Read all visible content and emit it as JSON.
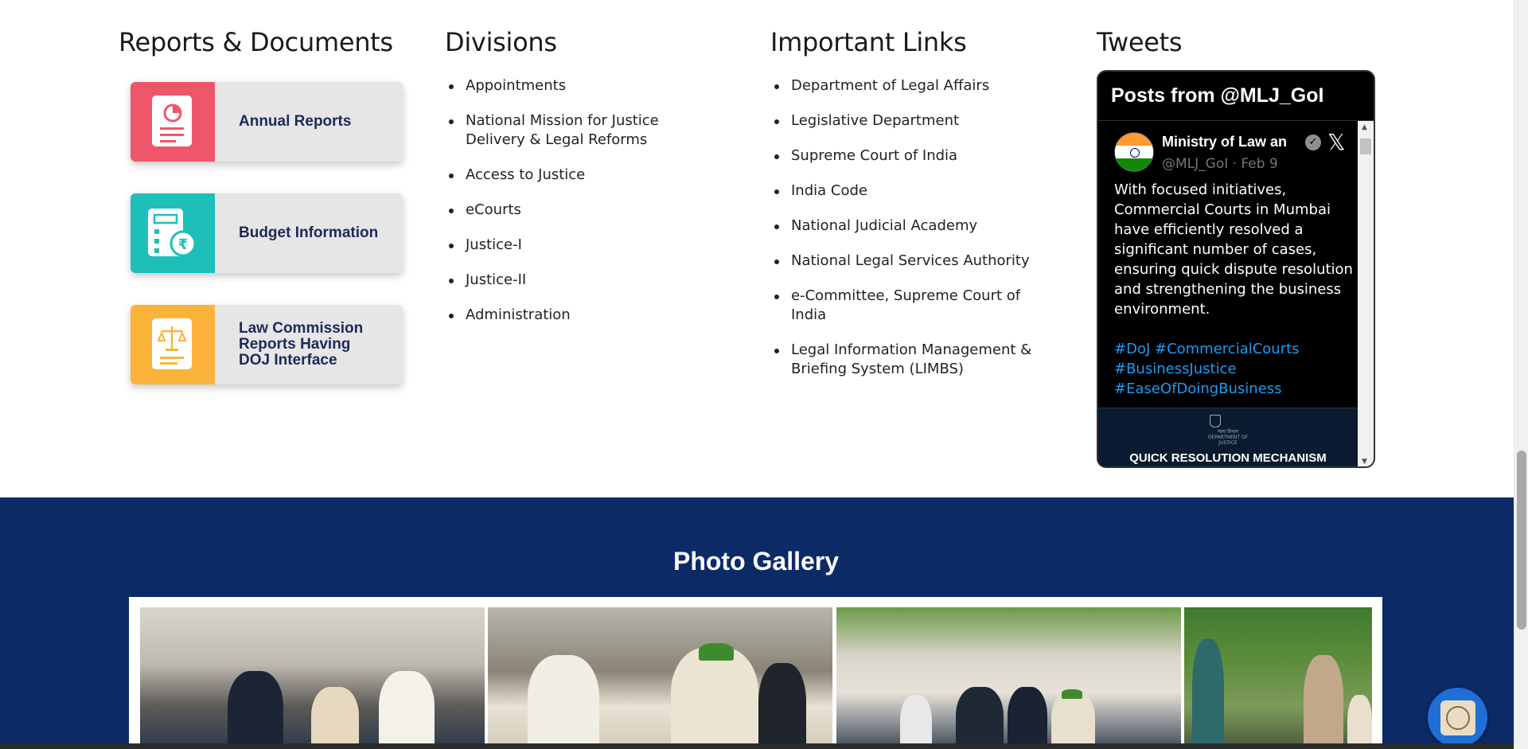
{
  "reports": {
    "heading": "Reports & Documents",
    "cards": [
      {
        "label": "Annual Reports",
        "color": "#f0566a"
      },
      {
        "label": "Budget Information",
        "color": "#1dbfb8"
      },
      {
        "label": "Law Commission Reports Having DOJ Interface",
        "color": "#fbb33a"
      }
    ]
  },
  "divisions": {
    "heading": "Divisions",
    "items": [
      "Appointments",
      "National Mission for Justice Delivery & Legal Reforms",
      "Access to Justice",
      "eCourts",
      "Justice-I",
      "Justice-II",
      "Administration"
    ]
  },
  "important_links": {
    "heading": "Important Links",
    "items": [
      "Department of Legal Affairs",
      "Legislative Department",
      "Supreme Court of India",
      "India Code",
      "National Judicial Academy",
      "National Legal Services Authority",
      "e-Committee, Supreme Court of India",
      "Legal Information Management & Briefing System (LIMBS)"
    ]
  },
  "tweets": {
    "heading": "Tweets",
    "widget_title": "Posts from @MLJ_GoI",
    "author_name": "Ministry of Law an",
    "author_handle": "@MLJ_GoI · Feb 9",
    "text": "With focused initiatives, Commercial Courts in Mumbai have efficiently resolved a significant number of cases, ensuring quick dispute resolution and strengthening the business environment.",
    "hashtags": [
      "#DoJ #CommercialCourts",
      "#BusinessJustice",
      "#EaseOfDoingBusiness"
    ],
    "media_caption": "QUICK RESOLUTION MECHANISM",
    "media_emblem_text": "न्याय विभाग DEPARTMENT OF JUSTICE"
  },
  "gallery": {
    "title": "Photo Gallery",
    "background": "#0c2a66"
  },
  "icons": [
    "pie-chart-document-icon",
    "budget-rupee-icon",
    "scales-document-icon",
    "verified-badge-icon",
    "x-logo-icon",
    "emblem-seal-icon"
  ]
}
